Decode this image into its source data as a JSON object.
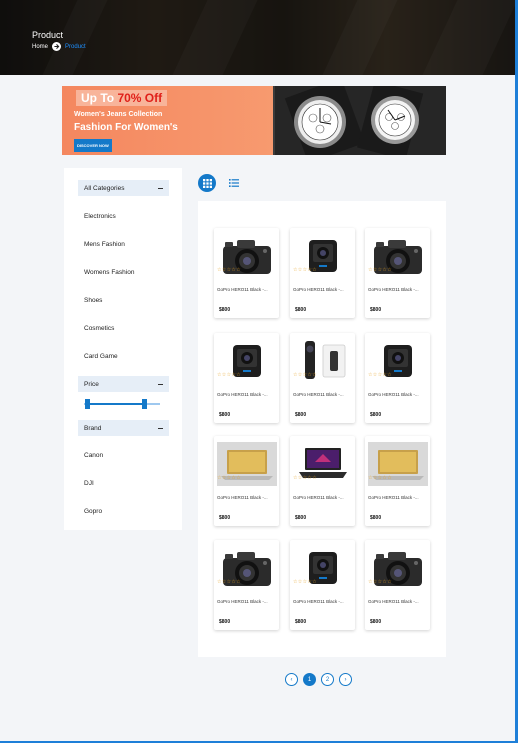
{
  "hero": {
    "title": "Product",
    "crumb_home": "Home",
    "crumb_current": "Product"
  },
  "promo": {
    "upto": "Up To",
    "percent": "70% Off",
    "subtitle": "Women's Jeans Collection",
    "headline": "Fashion For Women's",
    "cta": "DISCOVER NOW"
  },
  "sidebar": {
    "categories_title": "All Categories",
    "categories": [
      "Electronics",
      "Mens Fashion",
      "Womens Fashion",
      "Shoes",
      "Cosmetics",
      "Card Game"
    ],
    "price_title": "Price",
    "brand_title": "Brand",
    "brands": [
      "Canon",
      "DJI",
      "Gopro"
    ]
  },
  "products": [
    {
      "name": "GoPro HERO11 Black -...",
      "price": "$800",
      "icon": "dslr-camera-icon"
    },
    {
      "name": "GoPro HERO11 Black -...",
      "price": "$800",
      "icon": "action-camera-icon"
    },
    {
      "name": "GoPro HERO11 Black -...",
      "price": "$800",
      "icon": "dslr-camera-icon"
    },
    {
      "name": "GoPro HERO11 Black -...",
      "price": "$800",
      "icon": "action-camera-icon"
    },
    {
      "name": "GoPro HERO11 Black -...",
      "price": "$800",
      "icon": "360-camera-icon"
    },
    {
      "name": "GoPro HERO11 Black -...",
      "price": "$800",
      "icon": "action-camera-icon"
    },
    {
      "name": "GoPro HERO11 Black -...",
      "price": "$800",
      "icon": "laptop-icon"
    },
    {
      "name": "GoPro HERO11 Black -...",
      "price": "$800",
      "icon": "gaming-laptop-icon"
    },
    {
      "name": "GoPro HERO11 Black -...",
      "price": "$800",
      "icon": "laptop-icon"
    },
    {
      "name": "GoPro HERO11 Black -...",
      "price": "$800",
      "icon": "dslr-camera-icon"
    },
    {
      "name": "GoPro HERO11 Black -...",
      "price": "$800",
      "icon": "action-camera-icon"
    },
    {
      "name": "GoPro HERO11 Black -...",
      "price": "$800",
      "icon": "dslr-camera-icon"
    }
  ],
  "stars": "☆☆☆☆☆",
  "pagination": {
    "prev": "‹",
    "pages": [
      "1",
      "2"
    ],
    "current": "1",
    "next": "›"
  },
  "colors": {
    "accent": "#1479c9",
    "promo": "#f4875f",
    "star": "#e6a11f"
  }
}
